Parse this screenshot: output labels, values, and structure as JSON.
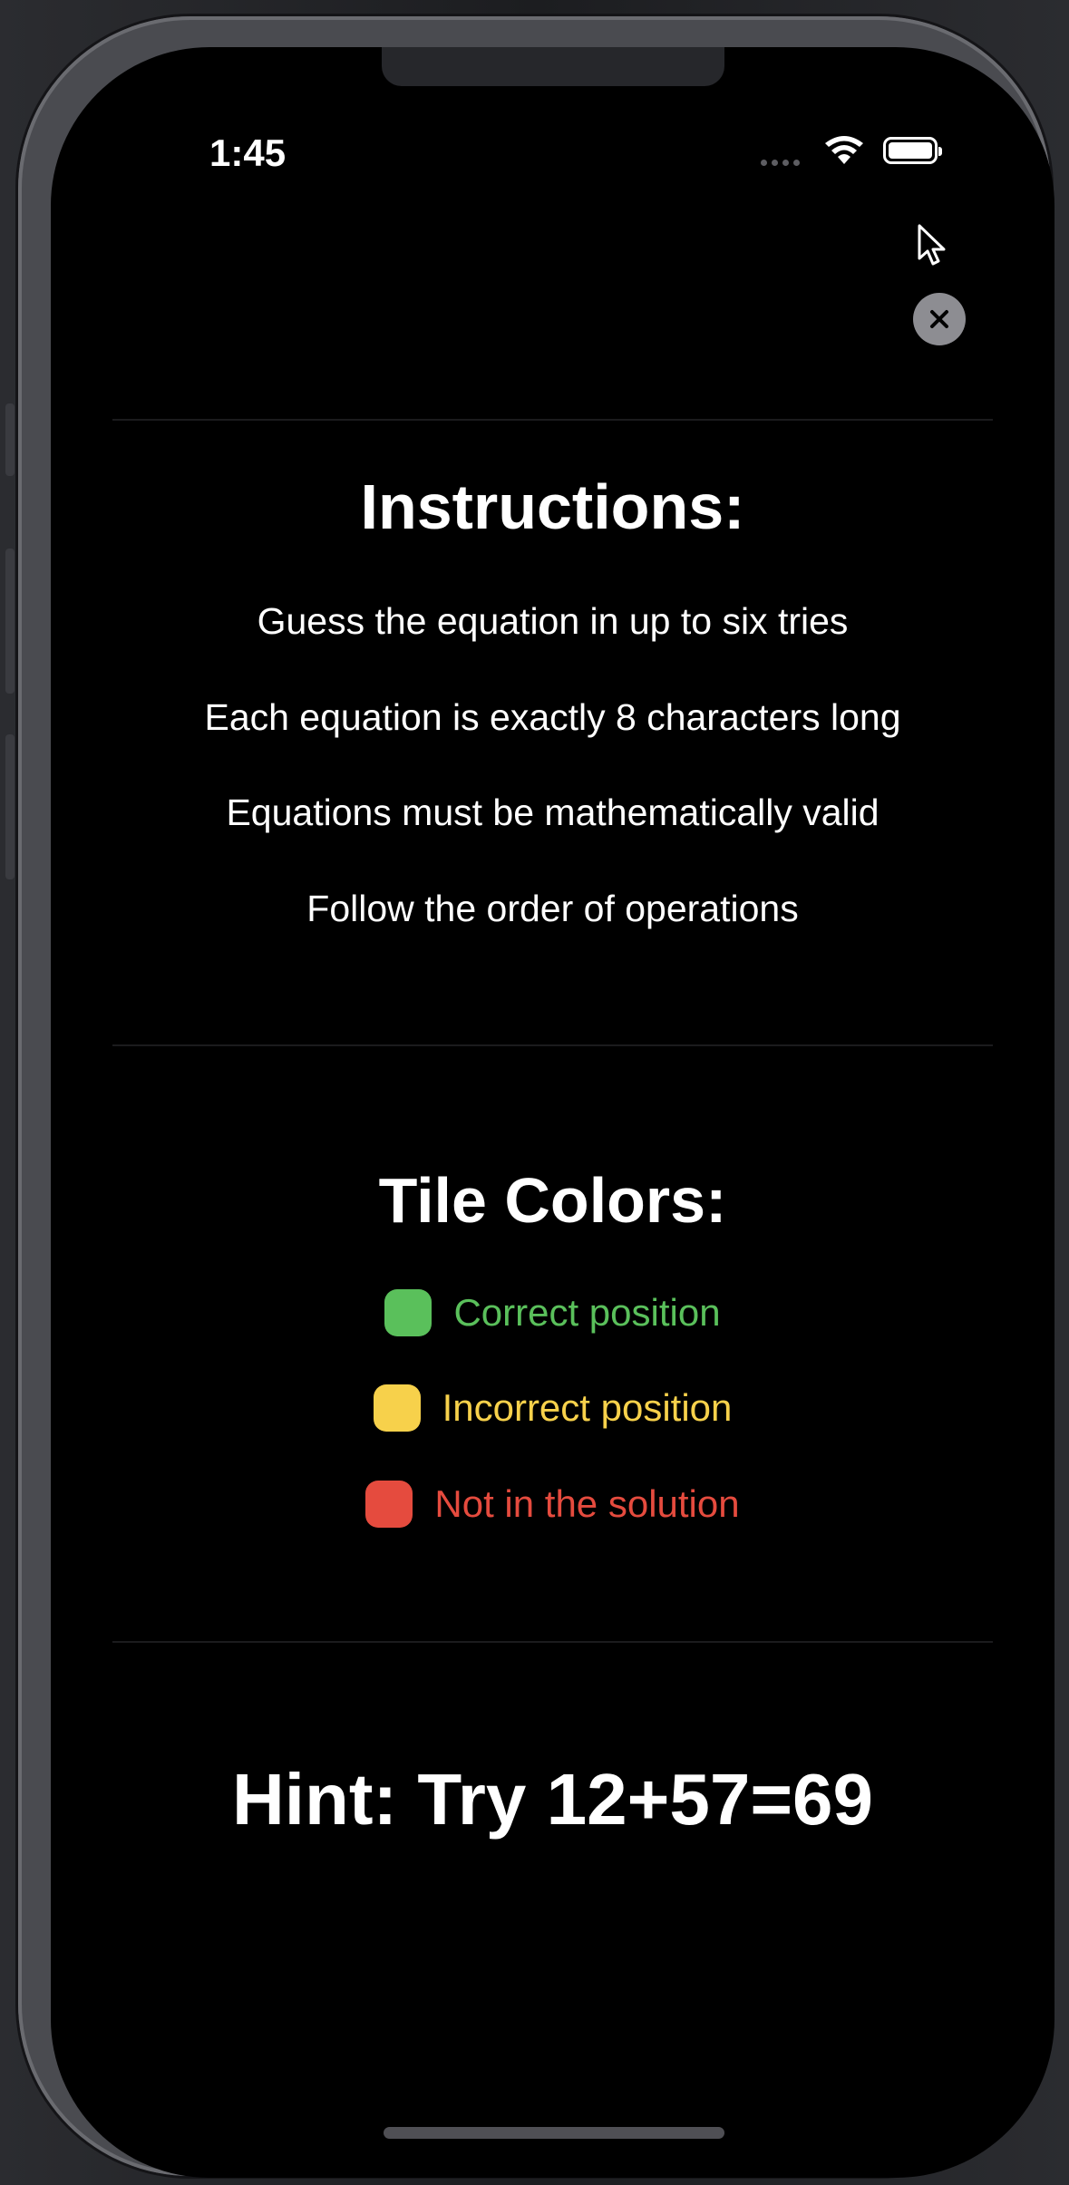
{
  "status_bar": {
    "time": "1:45",
    "icons": [
      "cellular-dots-icon",
      "wifi-icon",
      "battery-icon"
    ]
  },
  "close_button": {
    "icon": "close-icon"
  },
  "instructions": {
    "title": "Instructions:",
    "items": [
      "Guess the equation in up to six tries",
      "Each equation is exactly 8 characters long",
      "Equations must be mathematically valid",
      "Follow the order of operations"
    ]
  },
  "tile_colors": {
    "title": "Tile Colors:",
    "items": [
      {
        "label": "Correct position",
        "color": "#5ac05b"
      },
      {
        "label": "Incorrect position",
        "color": "#f7d14b"
      },
      {
        "label": "Not in the solution",
        "color": "#e54b3e"
      }
    ]
  },
  "hint": {
    "text": "Hint: Try 12+57=69"
  },
  "colors": {
    "background": "#000000",
    "text": "#ffffff",
    "close_button": "#8d8d92"
  }
}
